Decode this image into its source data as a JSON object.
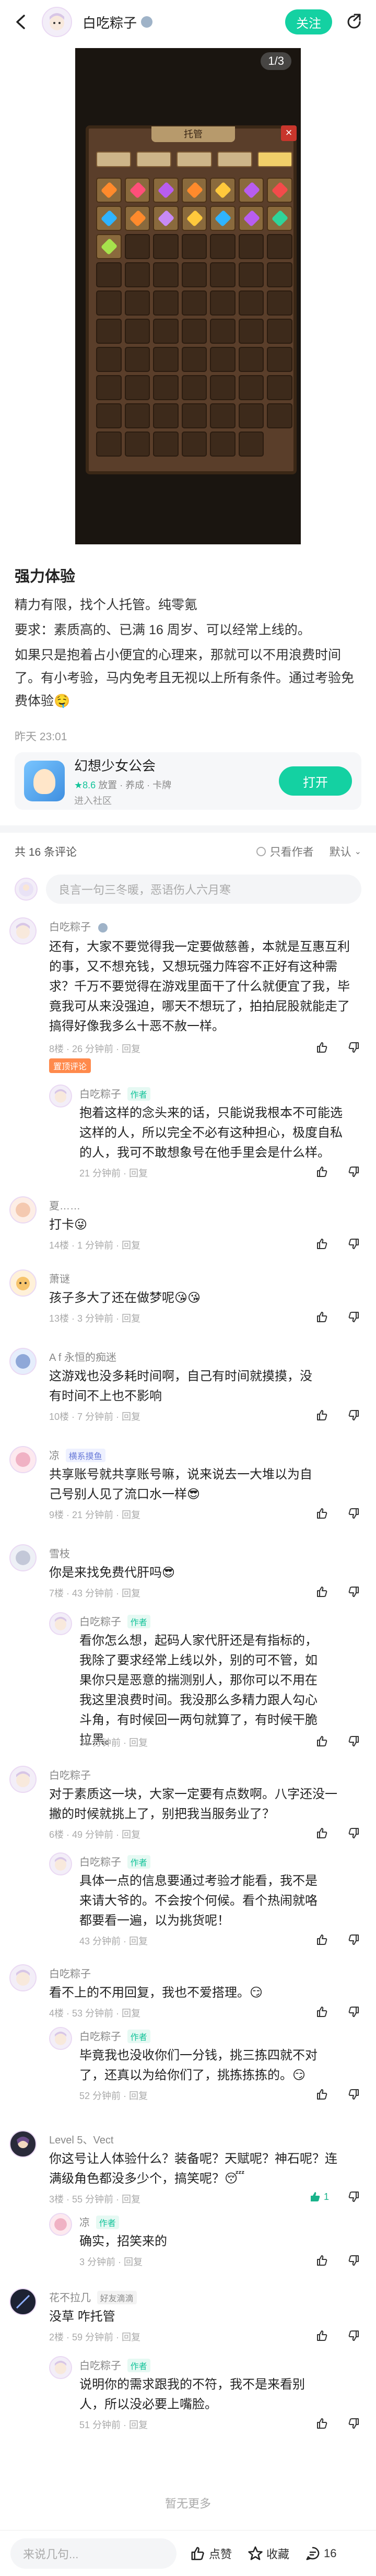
{
  "header": {
    "author_name": "白吃粽子",
    "follow_label": "关注"
  },
  "gallery": {
    "counter": "1/3",
    "game_title": "托管"
  },
  "post": {
    "title": "强力体验",
    "paragraphs": [
      "精力有限，找个人托管。纯零氪",
      "要求：素质高的、已满 16 周岁、可以经常上线的。",
      "如果只是抱着占小便宜的心理来，那就可以不用浪费时间了。有小考验，马内免考且无视以上所有条件。通过考验免费体验🤤"
    ],
    "time": "昨天 23:01"
  },
  "game_card": {
    "name": "幻想少女公会",
    "score": "★8.6",
    "tags": "放置 · 养成 · 卡牌",
    "forum": "进入社区",
    "open_label": "打开"
  },
  "comments_header": {
    "count": "共 16 条评论",
    "only_author": "只看作者",
    "sort": "默认"
  },
  "comment_input": {
    "placeholder": "良言一句三冬暖，恶语伤人六月寒"
  },
  "comments": [
    {
      "name": "白吃粽子",
      "text": "还有，大家不要觉得我一定要做慈善，本就是互惠互利的事，又不想充钱，又想玩强力阵容不正好有这种需求？千万不要觉得在游戏里面干了什么就便宜了我，毕竟我可从来没强迫，哪天不想玩了，拍拍屁股就能走了搞得好像我多么十恶不赦一样。",
      "meta": "8楼 · 26 分钟前 · 回复",
      "badge": "置顶评论"
    },
    {
      "name": "白吃粽子",
      "author_tag": "作者",
      "text": "抱着这样的念头来的话，只能说我根本不可能选这样的人，所以完全不必有这种担心，极度自私的人，我可不敢想象号在他手里会是什么样。",
      "meta": "21 分钟前 · 回复"
    },
    {
      "name": "夏……",
      "text": "打卡😜",
      "meta": "14楼 · 1 分钟前 · 回复"
    },
    {
      "name": "萧谜",
      "text": "孩子多大了还在做梦呢😘😘",
      "meta": "13楼 · 3 分钟前 · 回复"
    },
    {
      "name": "A f 永恒的痴迷",
      "text": "这游戏也没多耗时间啊，自己有时间就摸摸，没有时间不上也不影响",
      "meta": "10楼 · 7 分钟前 · 回复"
    },
    {
      "name": "凉",
      "player_tag": "横系摸鱼",
      "text": "共享账号就共享账号嘛，说来说去一大堆以为自己号别人见了流口水一样😎",
      "meta": "9楼 · 21 分钟前 · 回复"
    },
    {
      "name": "雪枝",
      "text": "你是来找免费代肝吗😎",
      "meta": "7楼 · 43 分钟前 · 回复"
    },
    {
      "name": "白吃粽子",
      "author_tag": "作者",
      "text": "看你怎么想，起码人家代肝还是有指标的，我除了要求经常上线以外，别的可不管，如果你只是恶意的揣测别人，那你可以不用在我这里浪费时间。我没那么多精力跟人勾心斗角，有时候回一两句就算了，有时候干脆拉黑。",
      "meta": "36 分钟前 · 回复"
    },
    {
      "name": "白吃粽子",
      "text": "对于素质这一块，大家一定要有点数啊。八字还没一撇的时候就挑上了，别把我当服务业了？",
      "meta": "6楼 · 49 分钟前 · 回复"
    },
    {
      "name": "白吃粽子",
      "author_tag": "作者",
      "text": "具体一点的信息要通过考验才能看，我不是来请大爷的。不会按个何候。看个热闹就咯都要看一遍，以为挑货呢！",
      "meta": "43 分钟前 · 回复"
    },
    {
      "name": "白吃粽子",
      "text": "看不上的不用回复，我也不爱搭理。😏",
      "meta": "4楼 · 53 分钟前 · 回复"
    },
    {
      "name": "白吃粽子",
      "author_tag": "作者",
      "text": "毕竟我也没收你们一分钱，挑三拣四就不对了，还真以为给你们了，挑拣拣拣的。😏",
      "meta": "52 分钟前 · 回复"
    },
    {
      "name": "Level 5、Vect",
      "text": "你这号让人体验什么？装备呢？天赋呢？神石呢？连满级角色都没多少个，搞笑呢？😴",
      "meta": "3楼 · 55 分钟前 · 回复",
      "likes": "1"
    },
    {
      "name": "凉",
      "author_tag": "作者",
      "text": "确实，招笑来的",
      "meta": "3 分钟前 · 回复"
    },
    {
      "name": "花不拉几",
      "friend_tag": "好友滴滴",
      "text": "没草 咋托管",
      "meta": "2楼 · 59 分钟前 · 回复"
    },
    {
      "name": "白吃粽子",
      "author_tag": "作者",
      "text": "说明你的需求跟我的不符，我不是来看别人，所以没必要上嘴脸。",
      "meta": "51 分钟前 · 回复"
    }
  ],
  "footer": {
    "no_more": "暂无更多"
  },
  "bottom_bar": {
    "placeholder": "来说几句...",
    "like_label": "点赞",
    "fav_label": "收藏",
    "comment_count": "16"
  },
  "colors": {
    "accent": "#14d1a2",
    "author_tag": "#14c49a",
    "hot_tag": "#ff8a4c"
  }
}
